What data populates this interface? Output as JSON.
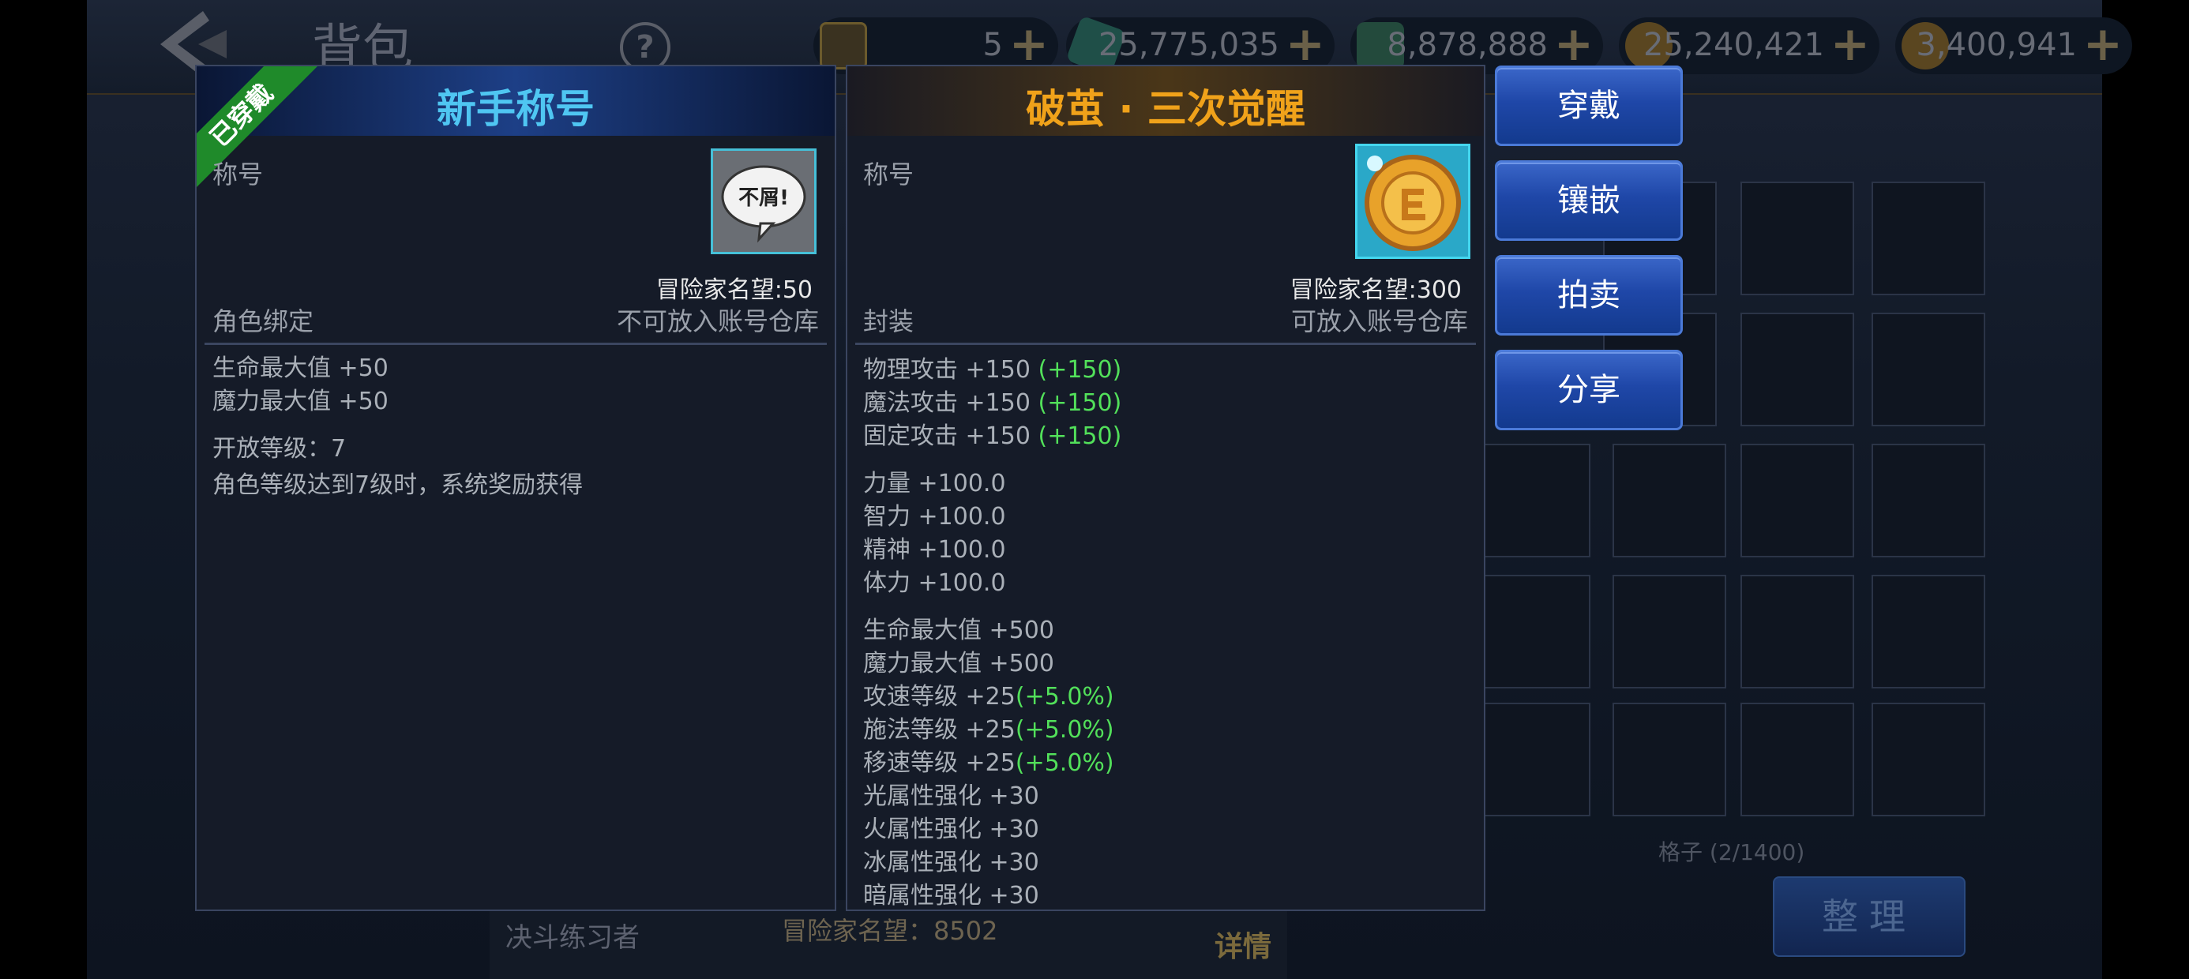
{
  "topbar": {
    "title": "背包",
    "help": "?",
    "currencies": [
      {
        "icon": "emblem-icon",
        "amount": "5"
      },
      {
        "icon": "green-crystal-icon",
        "amount": "25,775,035"
      },
      {
        "icon": "green-gem-icon",
        "amount": "8,878,888"
      },
      {
        "icon": "gold-coin-icon",
        "amount": "25,240,421"
      },
      {
        "icon": "locked-gold-coin-icon",
        "amount": "3,400,941"
      }
    ],
    "plus": "+"
  },
  "left_panel": {
    "title": "新手称号",
    "badge": "已穿戴",
    "type": "称号",
    "icon_text": "不屑!",
    "reputation": "冒险家名望:50",
    "bind": "角色绑定",
    "storage": "不可放入账号仓库",
    "stats": [
      "生命最大值 +50",
      "魔力最大值 +50"
    ],
    "open_level": "开放等级：7",
    "description": "角色等级达到7级时，系统奖励获得"
  },
  "right_panel": {
    "title": "破茧 · 三次觉醒",
    "type": "称号",
    "reputation": "冒险家名望:300",
    "bind": "封装",
    "storage": "可放入账号仓库",
    "attack": [
      {
        "text": "物理攻击 +150 ",
        "bonus": "(+150)"
      },
      {
        "text": "魔法攻击 +150 ",
        "bonus": "(+150)"
      },
      {
        "text": "固定攻击 +150 ",
        "bonus": "(+150)"
      }
    ],
    "base_stats": [
      "力量 +100.0",
      "智力 +100.0",
      "精神 +100.0",
      "体力 +100.0"
    ],
    "misc": [
      {
        "text": "生命最大值 +500",
        "bonus": ""
      },
      {
        "text": "魔力最大值 +500",
        "bonus": ""
      },
      {
        "text": "攻速等级 +25",
        "bonus": "(+5.0%)"
      },
      {
        "text": "施法等级 +25",
        "bonus": "(+5.0%)"
      },
      {
        "text": "移速等级 +25",
        "bonus": "(+5.0%)"
      },
      {
        "text": "光属性强化 +30",
        "bonus": ""
      },
      {
        "text": "火属性强化 +30",
        "bonus": ""
      },
      {
        "text": "冰属性强化 +30",
        "bonus": ""
      },
      {
        "text": "暗属性强化 +30",
        "bonus": ""
      }
    ]
  },
  "actions": [
    "穿戴",
    "镶嵌",
    "拍卖",
    "分享"
  ],
  "bag": {
    "count": "格子 (2/1400)",
    "sort": "整理"
  },
  "bottom": {
    "name": "决斗练习者",
    "reputation": "冒险家名望：8502",
    "detail": "详情"
  },
  "colors": {
    "left_title": "#4fc6f2",
    "right_title": "#f0a21a",
    "bonus": "#52e05a",
    "badge": "#1f8a2a"
  }
}
